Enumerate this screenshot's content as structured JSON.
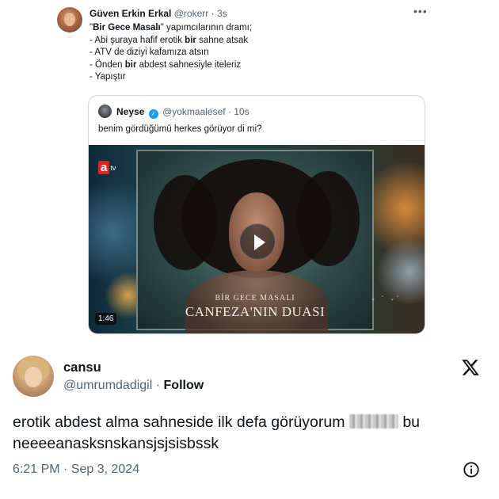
{
  "embedded_tweet": {
    "author_name": "Güven Erkin Erkal",
    "handle": "@rokerr",
    "separator": "·",
    "time": "3s",
    "more_label": "•••",
    "lines": [
      {
        "pre": "\"",
        "bold": "Bir Gece Masalı",
        "post": "\" yapımcılarının dramı;"
      },
      {
        "pre": "- Abi şuraya hafif erotik ",
        "bold": "bir",
        "post": " sahne atsak"
      },
      {
        "pre": "- ATV de diziyi kafamıza atsın",
        "bold": "",
        "post": ""
      },
      {
        "pre": "- Önden ",
        "bold": "bir",
        "post": " abdest sahnesiyle iteleriz"
      },
      {
        "pre": "- Yapıştır",
        "bold": "",
        "post": ""
      }
    ],
    "quoted": {
      "author_name": "Neyse",
      "verified_mark": "✓",
      "handle": "@yokmaalesef",
      "separator": "·",
      "time": "10s",
      "text": "benim gördüğümü herkes görüyor di mi?",
      "video": {
        "channel_logo_a": "a",
        "channel_logo_tv": "tv",
        "show_subtitle": "BİR GECE MASALI",
        "show_title": "CANFEZA'NIN DUASI",
        "duration": "1:46"
      }
    }
  },
  "tweet": {
    "author_name": "cansu",
    "handle": "@umrumdadigil",
    "separator": "·",
    "follow_label": "Follow",
    "text_before": "erotik abdest alma sahneside ilk defa görüyorum",
    "text_after": "bu neeeeanasksnskansjsjsisbssk",
    "timestamp": "6:21 PM · Sep 3, 2024"
  },
  "icons": {
    "platform_logo": "x-logo-icon",
    "info": "info-icon",
    "play": "play-icon"
  },
  "colors": {
    "text_primary": "#0f1419",
    "text_secondary": "#536471",
    "verified_blue": "#1d9bf0",
    "channel_red": "#e32224"
  }
}
